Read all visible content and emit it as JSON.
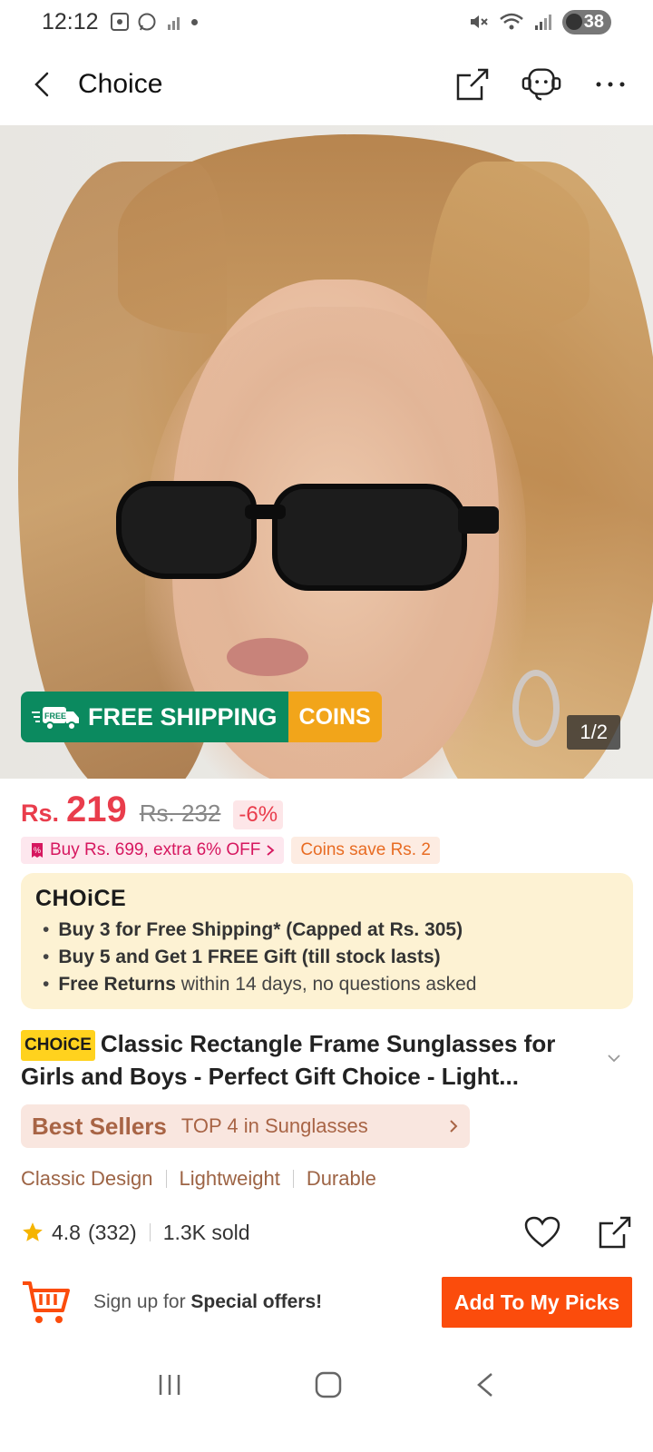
{
  "status_bar": {
    "time": "12:12",
    "battery": "38"
  },
  "header": {
    "title": "Choice"
  },
  "hero": {
    "free_shipping_label": "FREE SHIPPING",
    "free_tag": "FREE",
    "coins_label": "COINS",
    "image_counter": "1/2"
  },
  "price": {
    "currency": "Rs.",
    "current": "219",
    "original": "Rs. 232",
    "discount": "-6%"
  },
  "promos": {
    "extra_off": "Buy Rs. 699, extra 6% OFF",
    "coins_save": "Coins save Rs. 2"
  },
  "choice_box": {
    "logo": "CHOiCE",
    "bullets": [
      {
        "bold": "Buy 3 for  Free Shipping* (Capped at Rs. 305)",
        "rest": ""
      },
      {
        "bold": "Buy 5 and Get 1 FREE Gift (till stock lasts)",
        "rest": ""
      },
      {
        "bold": "Free Returns",
        "rest": " within 14 days, no questions asked"
      }
    ]
  },
  "product": {
    "choice_tag": "CHOiCE",
    "title": "Classic Rectangle Frame Sunglasses for Girls and Boys - Perfect Gift Choice - Light..."
  },
  "best_sellers": {
    "label": "Best Sellers",
    "text": "TOP 4 in Sunglasses"
  },
  "features": [
    "Classic Design",
    "Lightweight",
    "Durable"
  ],
  "rating": {
    "score": "4.8",
    "count": "(332)",
    "sold": "1.3K sold"
  },
  "bottom_bar": {
    "signup_prefix": "Sign up for ",
    "signup_bold": "Special offers!",
    "picks_button": "Add To My Picks"
  },
  "colors": {
    "price_red": "#e93d4c",
    "shipping_green": "#0b8a5f",
    "coins_orange": "#f2a51a",
    "cta_orange": "#fb4c0c",
    "choice_yellow": "#fdf2d3"
  }
}
